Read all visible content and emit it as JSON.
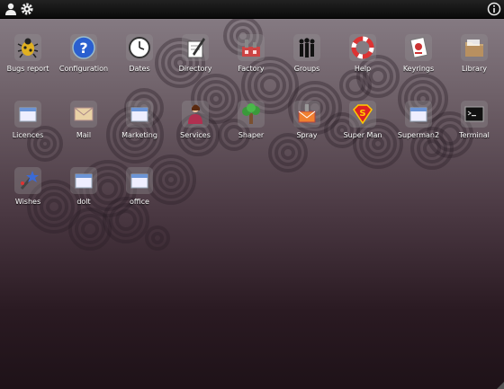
{
  "topbar": {
    "icons": [
      "user-icon",
      "gear-icon",
      "info-icon"
    ]
  },
  "apps": [
    {
      "label": "Bugs report",
      "icon": "bug-icon"
    },
    {
      "label": "Configuration",
      "icon": "help-question-icon"
    },
    {
      "label": "Dates",
      "icon": "clock-icon"
    },
    {
      "label": "Directory",
      "icon": "pen-directory-icon"
    },
    {
      "label": "Factory",
      "icon": "factory-icon"
    },
    {
      "label": "Groups",
      "icon": "people-group-icon"
    },
    {
      "label": "Help",
      "icon": "lifebuoy-icon"
    },
    {
      "label": "Keyrings",
      "icon": "keyring-icon"
    },
    {
      "label": "Library",
      "icon": "folder-icon"
    },
    {
      "label": "Licences",
      "icon": "window-icon"
    },
    {
      "label": "Mail",
      "icon": "envelope-icon"
    },
    {
      "label": "Marketing",
      "icon": "window-icon"
    },
    {
      "label": "Services",
      "icon": "person-icon"
    },
    {
      "label": "Shaper",
      "icon": "plant-icon"
    },
    {
      "label": "Spray",
      "icon": "spray-mail-icon"
    },
    {
      "label": "Super Man",
      "icon": "superman-icon"
    },
    {
      "label": "Superman2",
      "icon": "window-icon"
    },
    {
      "label": "Terminal",
      "icon": "terminal-icon"
    },
    {
      "label": "Wishes",
      "icon": "wand-icon"
    },
    {
      "label": "dolt",
      "icon": "window-icon"
    },
    {
      "label": "office",
      "icon": "window-icon"
    }
  ]
}
